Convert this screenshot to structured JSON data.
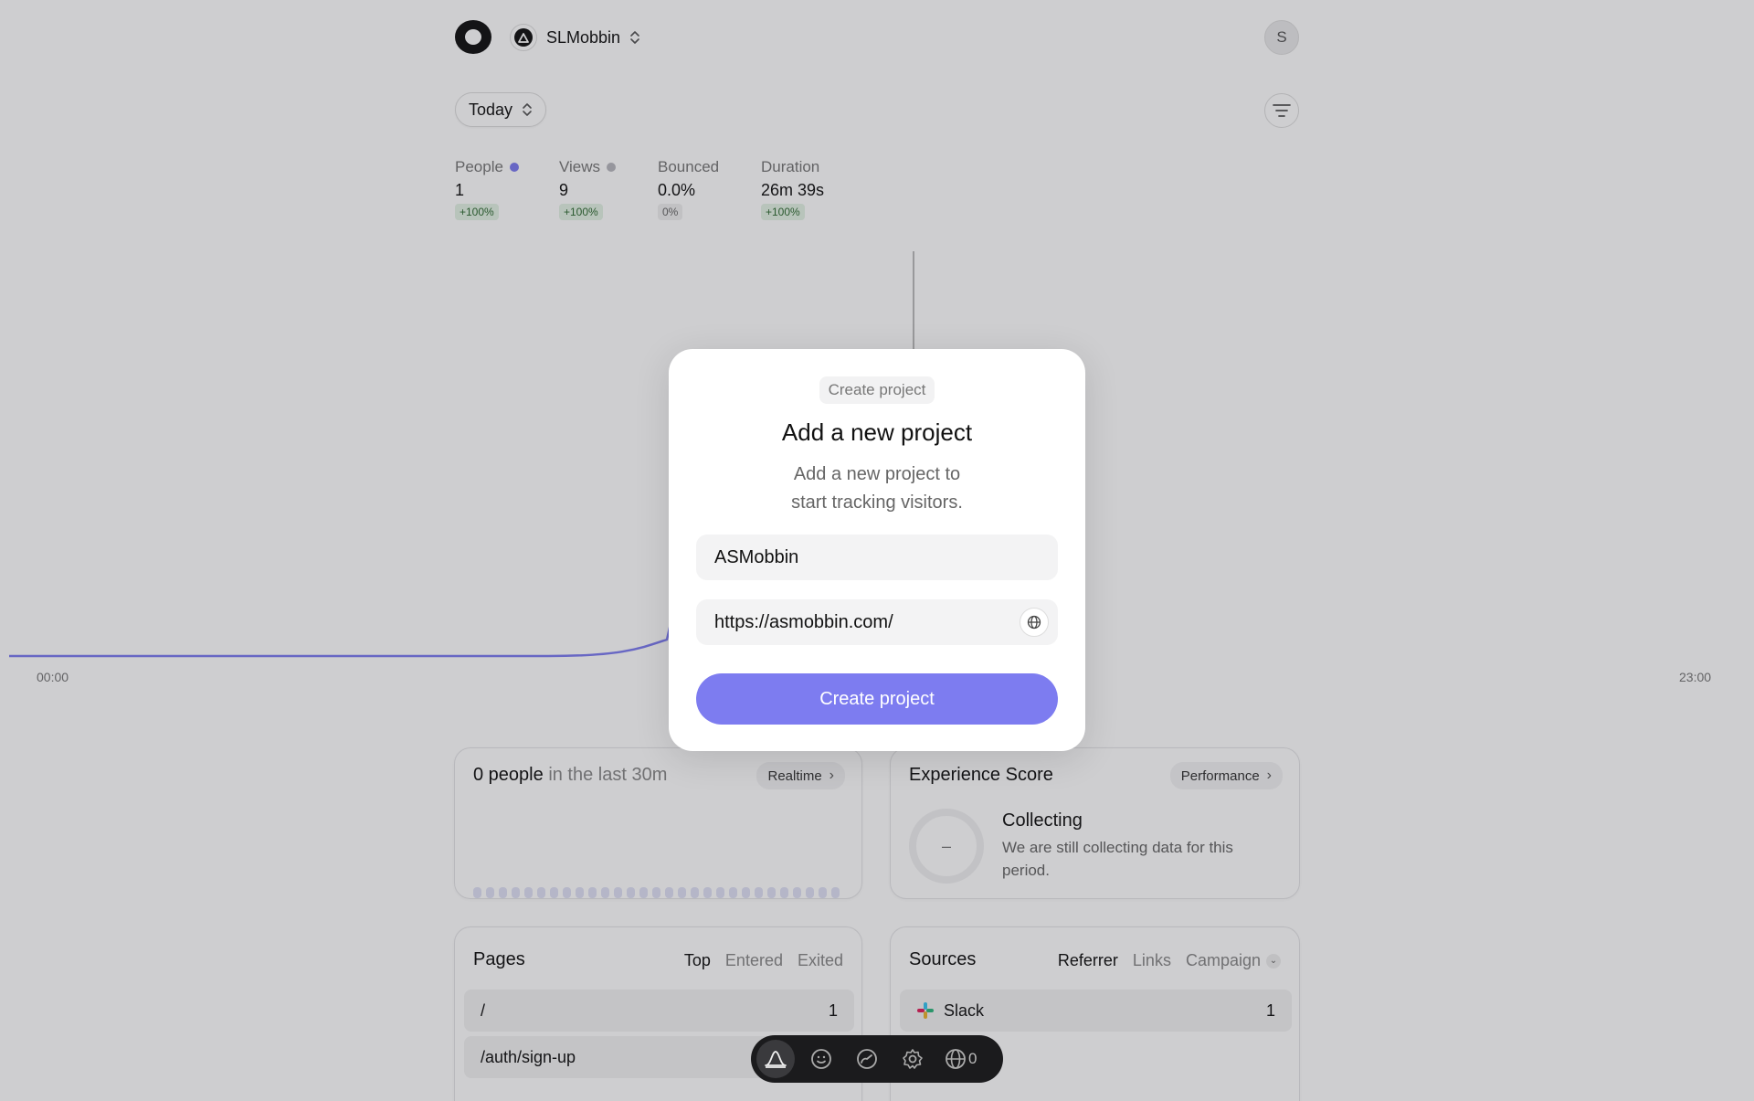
{
  "header": {
    "project_name": "SLMobbin",
    "avatar_initial": "S",
    "period": "Today"
  },
  "stats": [
    {
      "label": "People",
      "value": "1",
      "delta": "+100%",
      "dot": "#7d7cf0"
    },
    {
      "label": "Views",
      "value": "9",
      "delta": "+100%",
      "dot": "#b8b8be"
    },
    {
      "label": "Bounced",
      "value": "0.0%",
      "delta": "0%"
    },
    {
      "label": "Duration",
      "value": "26m 39s",
      "delta": "+100%"
    }
  ],
  "chart": {
    "x_start": "00:00",
    "x_end": "23:00",
    "line_color": "#7d7cf0"
  },
  "realtime": {
    "count": "0 people",
    "suffix": "in the last 30m",
    "link": "Realtime"
  },
  "experience": {
    "title": "Experience Score",
    "link": "Performance",
    "score": "–",
    "status": "Collecting",
    "description": "We are still collecting data for this period."
  },
  "pages": {
    "title": "Pages",
    "tabs": [
      "Top",
      "Entered",
      "Exited"
    ],
    "rows": [
      {
        "path": "/",
        "count": "1"
      },
      {
        "path": "/auth/sign-up",
        "count": ""
      }
    ]
  },
  "sources": {
    "title": "Sources",
    "tabs": [
      "Referrer",
      "Links",
      "Campaign"
    ],
    "rows": [
      {
        "name": "Slack",
        "count": "1"
      }
    ]
  },
  "modal": {
    "tag": "Create project",
    "title": "Add a new project",
    "desc_line1": "Add a new project to",
    "desc_line2": "start tracking visitors.",
    "name_value": "ASMobbin",
    "url_value": "https://asmobbin.com/",
    "submit": "Create project"
  },
  "dock": {
    "count": "0",
    "icons": [
      "analytics-icon",
      "smile-icon",
      "gauge-icon",
      "settings-icon",
      "globe-icon"
    ]
  }
}
